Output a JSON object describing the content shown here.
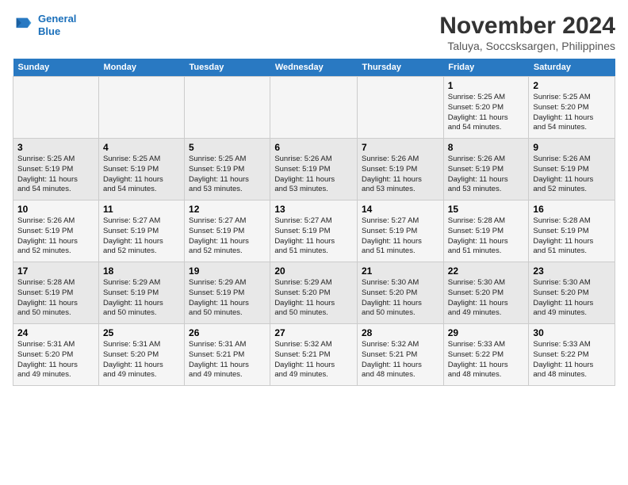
{
  "logo": {
    "line1": "General",
    "line2": "Blue"
  },
  "title": "November 2024",
  "location": "Taluya, Soccsksargen, Philippines",
  "weekdays": [
    "Sunday",
    "Monday",
    "Tuesday",
    "Wednesday",
    "Thursday",
    "Friday",
    "Saturday"
  ],
  "weeks": [
    [
      {
        "day": "",
        "info": ""
      },
      {
        "day": "",
        "info": ""
      },
      {
        "day": "",
        "info": ""
      },
      {
        "day": "",
        "info": ""
      },
      {
        "day": "",
        "info": ""
      },
      {
        "day": "1",
        "info": "Sunrise: 5:25 AM\nSunset: 5:20 PM\nDaylight: 11 hours\nand 54 minutes."
      },
      {
        "day": "2",
        "info": "Sunrise: 5:25 AM\nSunset: 5:20 PM\nDaylight: 11 hours\nand 54 minutes."
      }
    ],
    [
      {
        "day": "3",
        "info": "Sunrise: 5:25 AM\nSunset: 5:19 PM\nDaylight: 11 hours\nand 54 minutes."
      },
      {
        "day": "4",
        "info": "Sunrise: 5:25 AM\nSunset: 5:19 PM\nDaylight: 11 hours\nand 54 minutes."
      },
      {
        "day": "5",
        "info": "Sunrise: 5:25 AM\nSunset: 5:19 PM\nDaylight: 11 hours\nand 53 minutes."
      },
      {
        "day": "6",
        "info": "Sunrise: 5:26 AM\nSunset: 5:19 PM\nDaylight: 11 hours\nand 53 minutes."
      },
      {
        "day": "7",
        "info": "Sunrise: 5:26 AM\nSunset: 5:19 PM\nDaylight: 11 hours\nand 53 minutes."
      },
      {
        "day": "8",
        "info": "Sunrise: 5:26 AM\nSunset: 5:19 PM\nDaylight: 11 hours\nand 53 minutes."
      },
      {
        "day": "9",
        "info": "Sunrise: 5:26 AM\nSunset: 5:19 PM\nDaylight: 11 hours\nand 52 minutes."
      }
    ],
    [
      {
        "day": "10",
        "info": "Sunrise: 5:26 AM\nSunset: 5:19 PM\nDaylight: 11 hours\nand 52 minutes."
      },
      {
        "day": "11",
        "info": "Sunrise: 5:27 AM\nSunset: 5:19 PM\nDaylight: 11 hours\nand 52 minutes."
      },
      {
        "day": "12",
        "info": "Sunrise: 5:27 AM\nSunset: 5:19 PM\nDaylight: 11 hours\nand 52 minutes."
      },
      {
        "day": "13",
        "info": "Sunrise: 5:27 AM\nSunset: 5:19 PM\nDaylight: 11 hours\nand 51 minutes."
      },
      {
        "day": "14",
        "info": "Sunrise: 5:27 AM\nSunset: 5:19 PM\nDaylight: 11 hours\nand 51 minutes."
      },
      {
        "day": "15",
        "info": "Sunrise: 5:28 AM\nSunset: 5:19 PM\nDaylight: 11 hours\nand 51 minutes."
      },
      {
        "day": "16",
        "info": "Sunrise: 5:28 AM\nSunset: 5:19 PM\nDaylight: 11 hours\nand 51 minutes."
      }
    ],
    [
      {
        "day": "17",
        "info": "Sunrise: 5:28 AM\nSunset: 5:19 PM\nDaylight: 11 hours\nand 50 minutes."
      },
      {
        "day": "18",
        "info": "Sunrise: 5:29 AM\nSunset: 5:19 PM\nDaylight: 11 hours\nand 50 minutes."
      },
      {
        "day": "19",
        "info": "Sunrise: 5:29 AM\nSunset: 5:19 PM\nDaylight: 11 hours\nand 50 minutes."
      },
      {
        "day": "20",
        "info": "Sunrise: 5:29 AM\nSunset: 5:20 PM\nDaylight: 11 hours\nand 50 minutes."
      },
      {
        "day": "21",
        "info": "Sunrise: 5:30 AM\nSunset: 5:20 PM\nDaylight: 11 hours\nand 50 minutes."
      },
      {
        "day": "22",
        "info": "Sunrise: 5:30 AM\nSunset: 5:20 PM\nDaylight: 11 hours\nand 49 minutes."
      },
      {
        "day": "23",
        "info": "Sunrise: 5:30 AM\nSunset: 5:20 PM\nDaylight: 11 hours\nand 49 minutes."
      }
    ],
    [
      {
        "day": "24",
        "info": "Sunrise: 5:31 AM\nSunset: 5:20 PM\nDaylight: 11 hours\nand 49 minutes."
      },
      {
        "day": "25",
        "info": "Sunrise: 5:31 AM\nSunset: 5:20 PM\nDaylight: 11 hours\nand 49 minutes."
      },
      {
        "day": "26",
        "info": "Sunrise: 5:31 AM\nSunset: 5:21 PM\nDaylight: 11 hours\nand 49 minutes."
      },
      {
        "day": "27",
        "info": "Sunrise: 5:32 AM\nSunset: 5:21 PM\nDaylight: 11 hours\nand 49 minutes."
      },
      {
        "day": "28",
        "info": "Sunrise: 5:32 AM\nSunset: 5:21 PM\nDaylight: 11 hours\nand 48 minutes."
      },
      {
        "day": "29",
        "info": "Sunrise: 5:33 AM\nSunset: 5:22 PM\nDaylight: 11 hours\nand 48 minutes."
      },
      {
        "day": "30",
        "info": "Sunrise: 5:33 AM\nSunset: 5:22 PM\nDaylight: 11 hours\nand 48 minutes."
      }
    ]
  ]
}
